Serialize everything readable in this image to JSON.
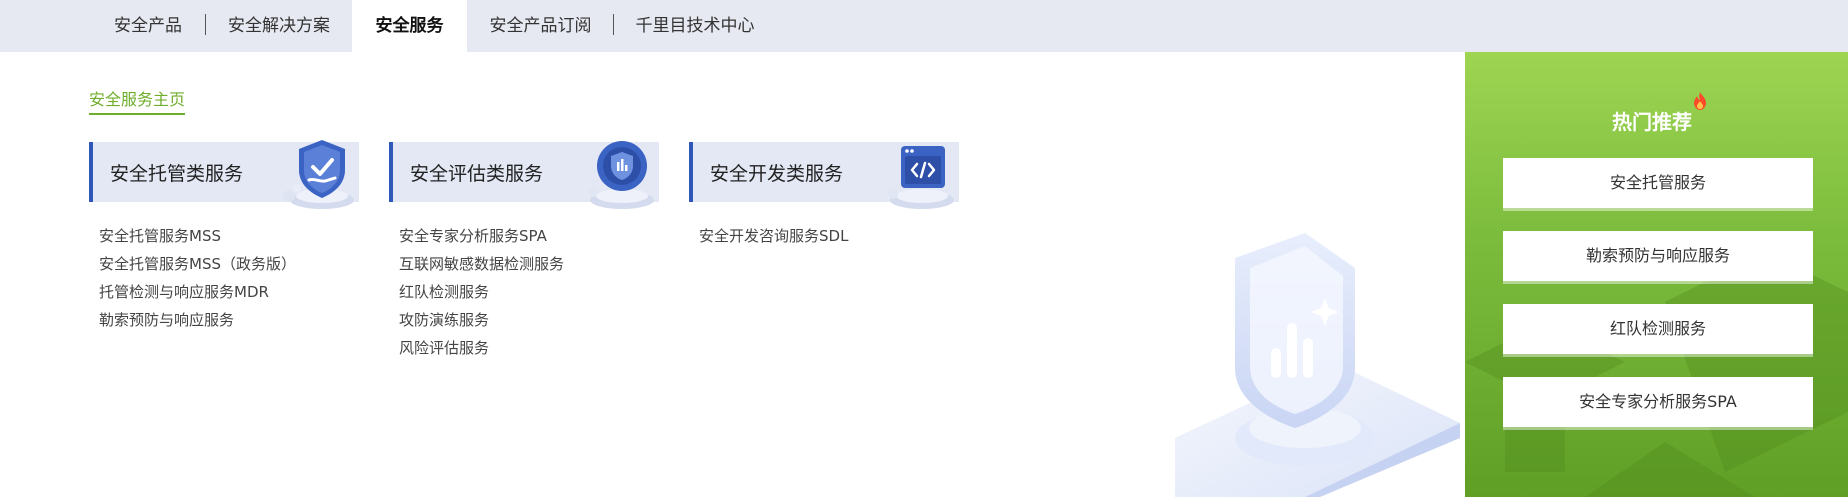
{
  "nav": {
    "tabs": [
      {
        "label": "安全产品",
        "active": false
      },
      {
        "label": "安全解决方案",
        "active": false
      },
      {
        "label": "安全服务",
        "active": true
      },
      {
        "label": "安全产品订阅",
        "active": false
      },
      {
        "label": "千里目技术中心",
        "active": false
      }
    ]
  },
  "breadcrumb": {
    "label": "安全服务主页"
  },
  "categories": [
    {
      "title": "安全托管类服务",
      "icon": "shield-check-icon",
      "items": [
        "安全托管服务MSS",
        "安全托管服务MSS（政务版）",
        "托管检测与响应服务MDR",
        "勒索预防与响应服务"
      ]
    },
    {
      "title": "安全评估类服务",
      "icon": "shield-chart-icon",
      "items": [
        "安全专家分析服务SPA",
        "互联网敏感数据检测服务",
        "红队检测服务",
        "攻防演练服务",
        "风险评估服务"
      ]
    },
    {
      "title": "安全开发类服务",
      "icon": "code-window-icon",
      "items": [
        "安全开发咨询服务SDL"
      ]
    }
  ],
  "hot": {
    "title": "热门推荐",
    "icon": "fire-icon",
    "items": [
      "安全托管服务",
      "勒索预防与响应服务",
      "红队检测服务",
      "安全专家分析服务SPA"
    ]
  },
  "colors": {
    "accent_green": "#6fae2c",
    "accent_blue": "#2f58b8",
    "tab_bar": "#e6e9f1",
    "panel_green": "#7dbd3d"
  }
}
